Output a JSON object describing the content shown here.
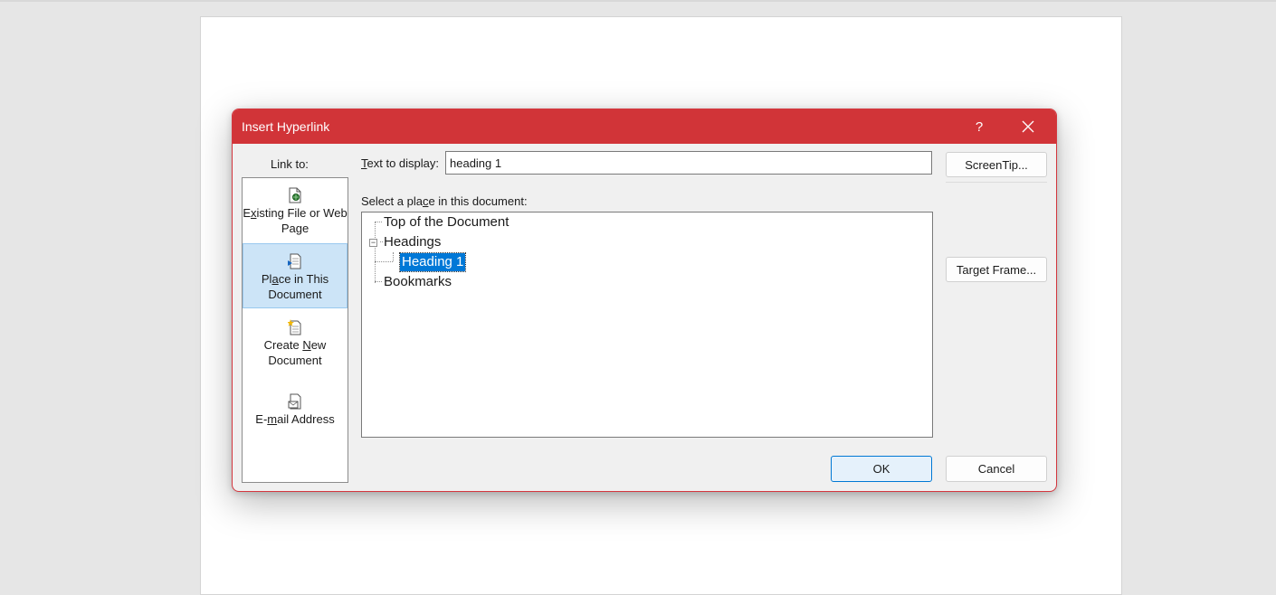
{
  "dialog": {
    "title": "Insert Hyperlink",
    "help_label": "?",
    "accent_color": "#d13438"
  },
  "link_to": {
    "label": "Link to:",
    "items": [
      {
        "label_pre": "E",
        "label_u": "x",
        "label_post": "isting File or Web Page",
        "icon": "existing-file-icon",
        "selected": false
      },
      {
        "label_pre": "Pl",
        "label_u": "a",
        "label_post": "ce in This Document",
        "icon": "place-in-document-icon",
        "selected": true
      },
      {
        "label_pre": "Create ",
        "label_u": "N",
        "label_post": "ew Document",
        "icon": "new-document-icon",
        "selected": false
      },
      {
        "label_pre": "E-",
        "label_u": "m",
        "label_post": "ail Address",
        "icon": "email-address-icon",
        "selected": false
      }
    ]
  },
  "text_to_display": {
    "label_u": "T",
    "label_rest": "ext to display:",
    "value": "heading 1"
  },
  "select_place": {
    "label_pre": "Select a pla",
    "label_u": "c",
    "label_post": "e in this document:"
  },
  "tree": {
    "top": "Top of the Document",
    "headings": "Headings",
    "heading1": "Heading 1",
    "bookmarks": "Bookmarks",
    "expander_symbol": "−"
  },
  "buttons": {
    "screentip": "ScreenTip...",
    "target_frame": "Target Frame...",
    "ok": "OK",
    "cancel": "Cancel"
  }
}
